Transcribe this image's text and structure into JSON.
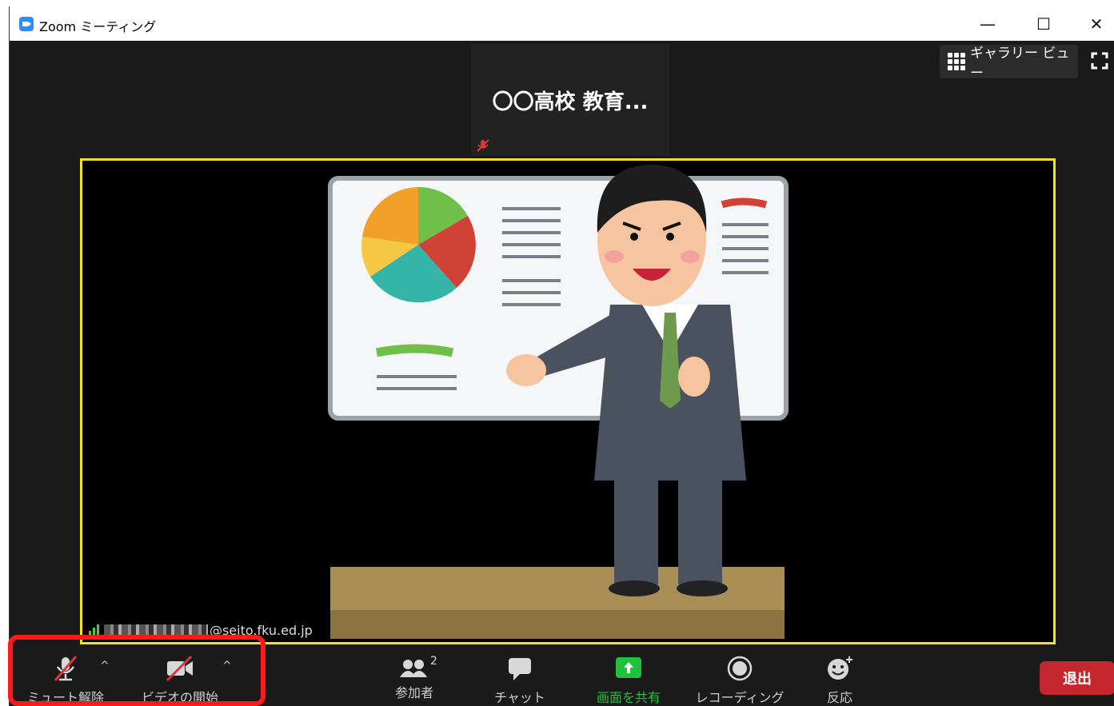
{
  "window": {
    "title": "Zoom ミーティング",
    "minimize": "—",
    "maximize": "☐",
    "close": "✕"
  },
  "meeting": {
    "thumbnail_name": "〇〇高校 教育...",
    "gallery_view_label": "ギャラリー ビュー",
    "speaker_tag": "@seito.fku.ed.jp"
  },
  "toolbar": {
    "unmute_label": "ミュート解除",
    "start_video_label": "ビデオの開始",
    "participants_label": "参加者",
    "participants_count": "2",
    "chat_label": "チャット",
    "share_screen_label": "画面を共有",
    "recording_label": "レコーディング",
    "reactions_label": "反応",
    "leave_label": "退出"
  },
  "colors": {
    "share_green": "#21c23b",
    "leave_red": "#c4272e",
    "speaker_border": "#f4e21a",
    "highlight_red": "#ff1a1a"
  }
}
